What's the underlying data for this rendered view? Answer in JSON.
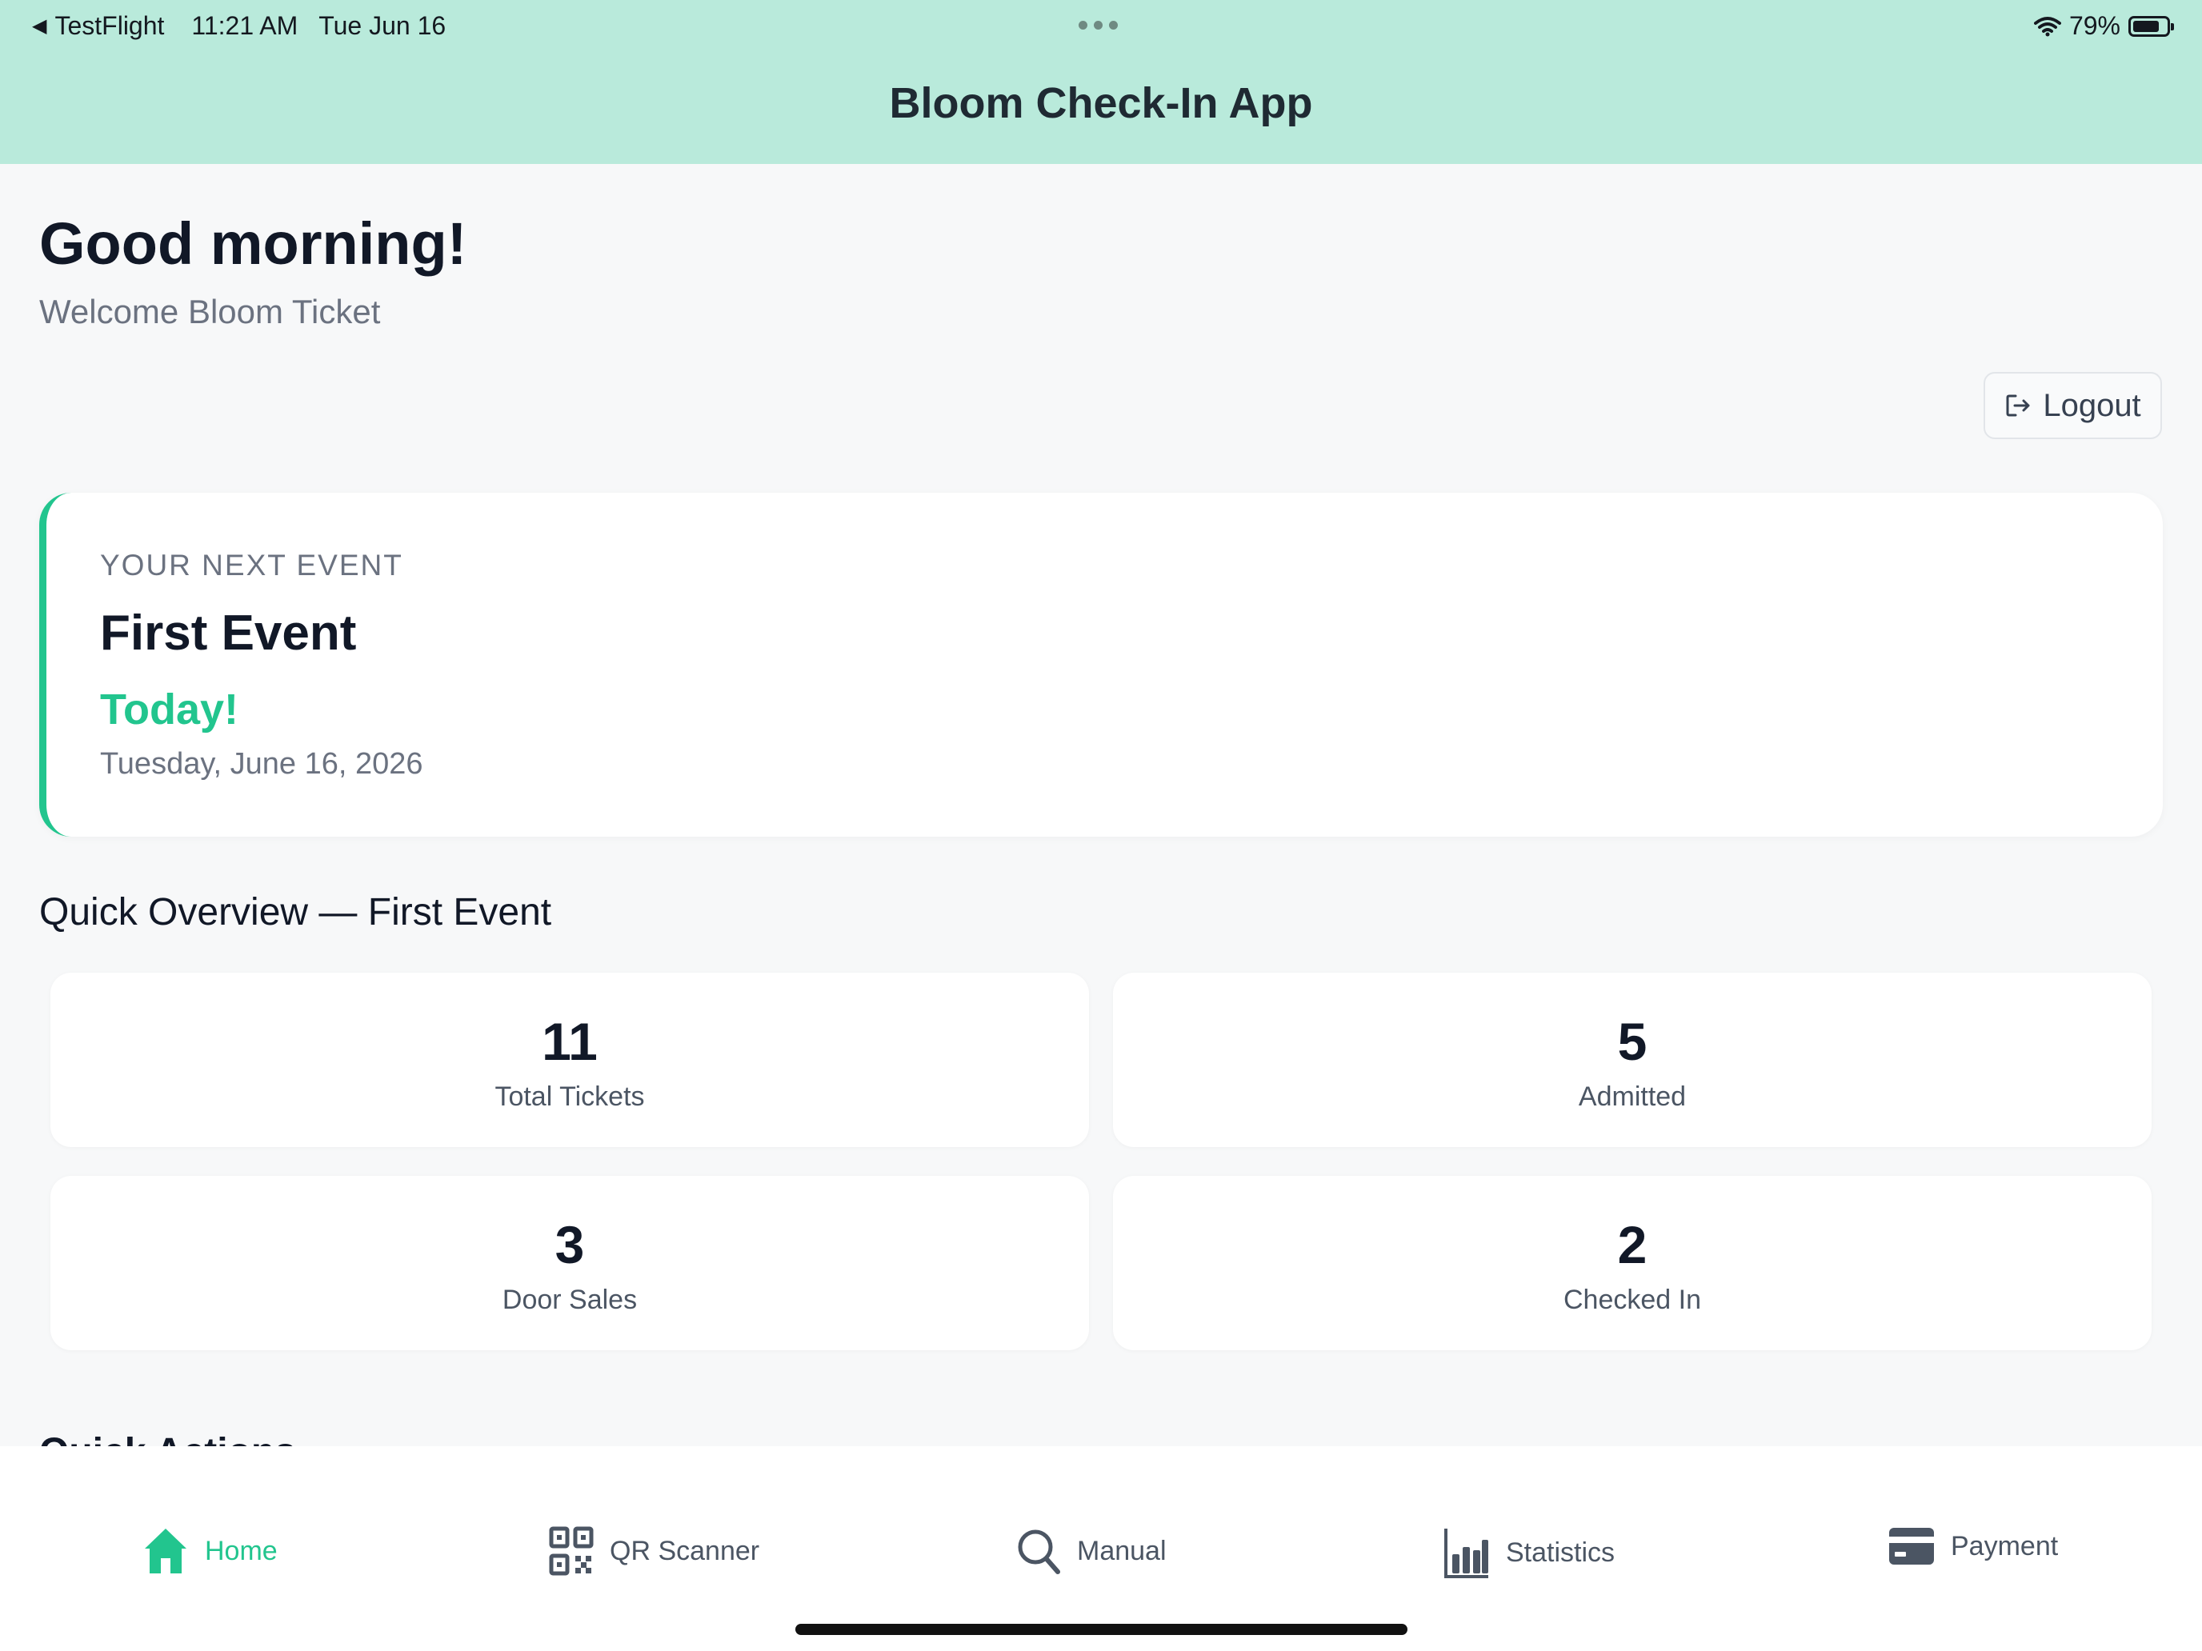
{
  "status_bar": {
    "back_app": "TestFlight",
    "time": "11:21 AM",
    "date": "Tue Jun 16",
    "battery_percent": "79%",
    "battery_level": 0.79
  },
  "nav": {
    "title": "Bloom Check-In App"
  },
  "greeting": {
    "title": "Good morning!",
    "subtitle": "Welcome Bloom Ticket"
  },
  "logout": {
    "label": "Logout"
  },
  "next_event": {
    "label": "YOUR NEXT EVENT",
    "name": "First Event",
    "when": "Today!",
    "date": "Tuesday, June 16, 2026"
  },
  "overview": {
    "title": "Quick Overview — First Event",
    "stats": [
      {
        "value": "11",
        "label": "Total Tickets"
      },
      {
        "value": "5",
        "label": "Admitted"
      },
      {
        "value": "3",
        "label": "Door Sales"
      },
      {
        "value": "2",
        "label": "Checked In"
      }
    ]
  },
  "next_section_peek": "Quick Actions",
  "tabs": [
    {
      "label": "Home",
      "icon": "home-icon",
      "active": true
    },
    {
      "label": "QR Scanner",
      "icon": "qr-code-icon",
      "active": false
    },
    {
      "label": "Manual",
      "icon": "search-icon",
      "active": false
    },
    {
      "label": "Statistics",
      "icon": "bar-chart-icon",
      "active": false
    },
    {
      "label": "Payment",
      "icon": "credit-card-icon",
      "active": false
    }
  ],
  "colors": {
    "accent": "#22c58e",
    "header": "#b9eadb"
  }
}
